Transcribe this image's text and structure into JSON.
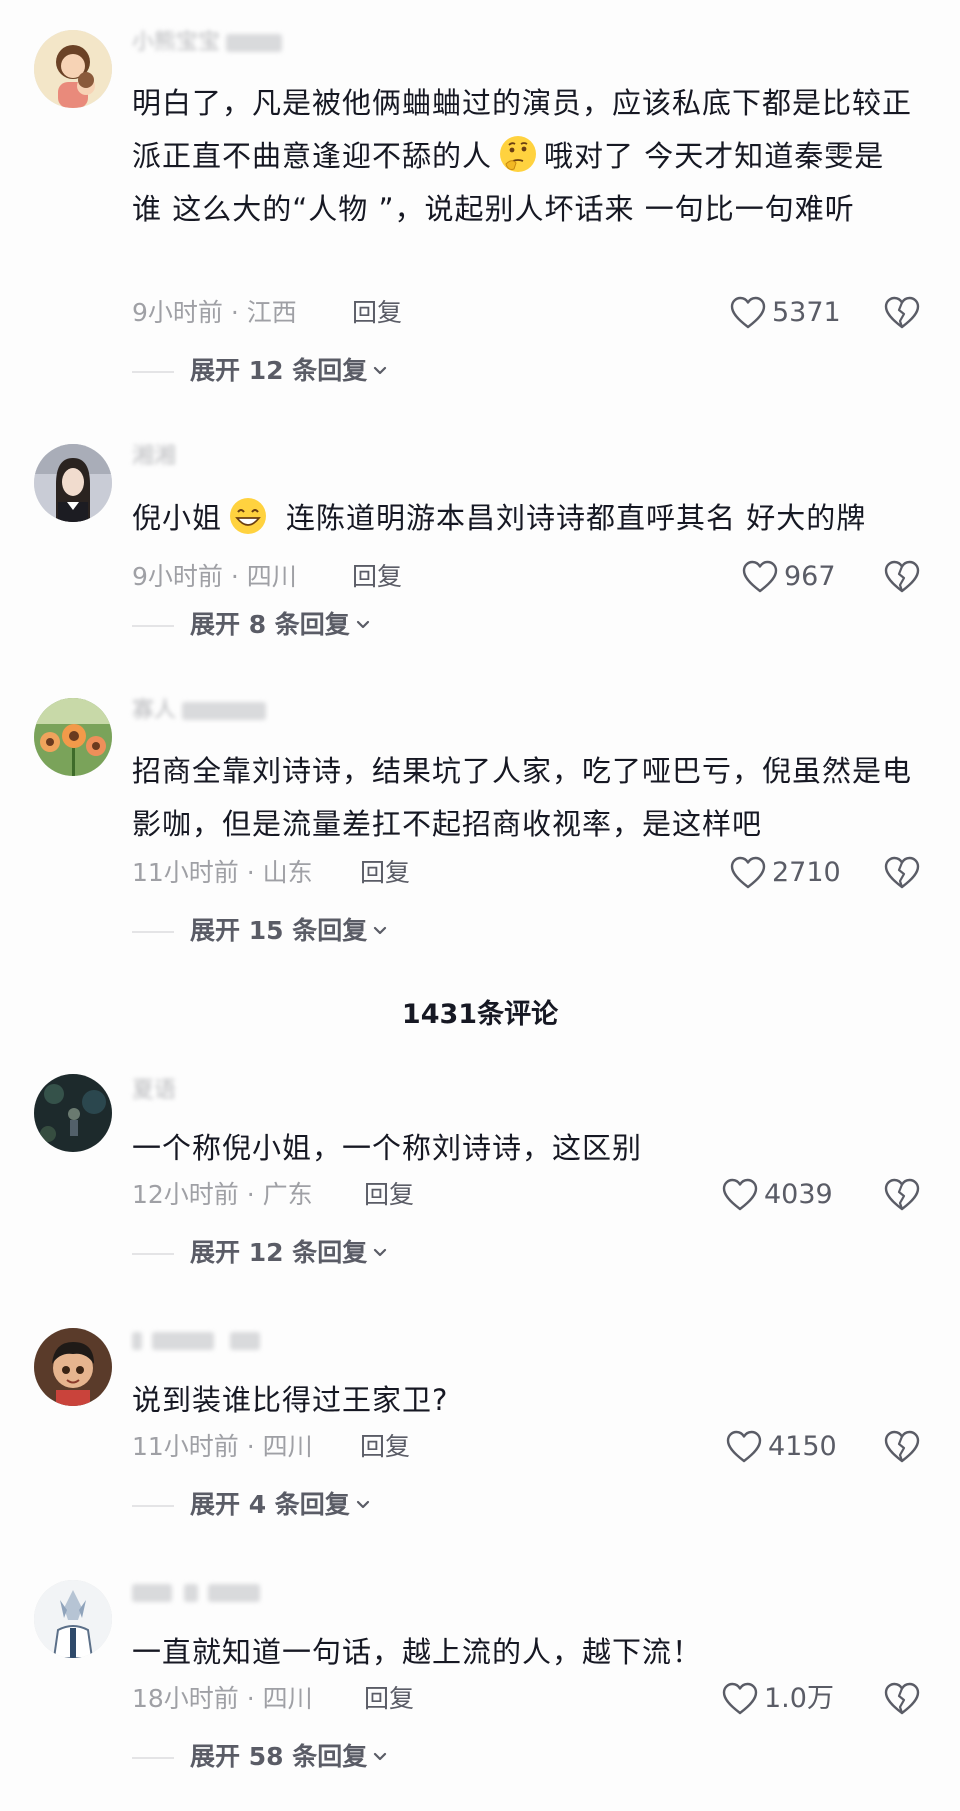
{
  "comments": [
    {
      "username": "小熊宝宝",
      "content_parts": [
        "明白了，凡是被他俩蛐蛐过的演员，应该私底下都是比较正派正直不曲意逢迎不舔的人",
        "哦对了 今天才知道秦雯是谁 这么大的“人物 ”，说起别人坏话来 一句比一句难听"
      ],
      "emoji": "thinking-face-emoji",
      "time_location": "9小时前 · 江西",
      "reply_label": "回复",
      "likes": "5371",
      "expand_label": "展开 12 条回复"
    },
    {
      "username": "湘湘",
      "content_parts": [
        "倪小姐",
        "连陈道明游本昌刘诗诗都直呼其名 好大的牌"
      ],
      "emoji": "grinning-face-emoji",
      "time_location": "9小时前 · 四川",
      "reply_label": "回复",
      "likes": "967",
      "expand_label": "展开 8 条回复"
    },
    {
      "username": "寡人",
      "content_parts": [
        "招商全靠刘诗诗，结果坑了人家，吃了哑巴亏，倪虽然是电影咖，但是流量差扛不起招商收视率，是这样吧"
      ],
      "time_location": "11小时前 · 山东",
      "reply_label": "回复",
      "likes": "2710",
      "expand_label": "展开 15 条回复"
    },
    {
      "username": "夏语",
      "content_parts": [
        "一个称倪小姐，一个称刘诗诗，这区别"
      ],
      "time_location": "12小时前 · 广东",
      "reply_label": "回复",
      "likes": "4039",
      "expand_label": "展开 12 条回复"
    },
    {
      "username": "",
      "content_parts": [
        "说到装谁比得过王家卫?"
      ],
      "time_location": "11小时前 · 四川",
      "reply_label": "回复",
      "likes": "4150",
      "expand_label": "展开 4 条回复"
    },
    {
      "username": "",
      "content_parts": [
        "一直就知道一句话，越上流的人，越下流！"
      ],
      "time_location": "18小时前 · 四川",
      "reply_label": "回复",
      "likes": "1.0万",
      "expand_label": "展开 58 条回复"
    }
  ],
  "total_comments": "1431条评论",
  "icons": {
    "like": "heart-outline-icon",
    "dislike": "broken-heart-icon",
    "expand": "chevron-down-icon"
  },
  "colors": {
    "text_primary": "#161823",
    "text_secondary": "#9fa0a5",
    "text_action": "#5a5c66",
    "background": "#fdfdfd"
  }
}
